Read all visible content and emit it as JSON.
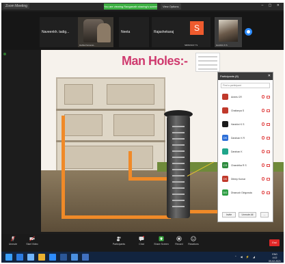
{
  "window": {
    "app_title": "Zoom Meeting"
  },
  "share_bar": {
    "label": "You are viewing Ranganath sharing's screen",
    "view_options": "View Options"
  },
  "participants_strip": [
    {
      "name": "Naveenkh. tadig...",
      "caption": ""
    },
    {
      "name": "",
      "caption": "Harika Kamesw..."
    },
    {
      "name": "Neeta",
      "caption": ""
    },
    {
      "name": "Rajashekaraj",
      "caption": ""
    },
    {
      "name": "",
      "caption": "SRINIVAS T S",
      "avatar_letter": "S"
    },
    {
      "name": "",
      "caption": "Harshini K S"
    }
  ],
  "slide": {
    "title": "Man Holes:-"
  },
  "participants_panel": {
    "title": "Participants (8)",
    "search_placeholder": "Find a participant",
    "items": [
      {
        "name": "Anees CR",
        "avatar_color": "#c0392b",
        "initials": ""
      },
      {
        "name": "Chaitanya S",
        "avatar_color": "#c0392b",
        "initials": ""
      },
      {
        "name": "Harshini K S",
        "avatar_color": "#1c1c1c",
        "initials": ""
      },
      {
        "name": "Darshan K R",
        "avatar_color": "#2d6fd8",
        "initials": "DK"
      },
      {
        "name": "Darshan K",
        "avatar_color": "#1fa58a",
        "initials": ""
      },
      {
        "name": "Chandrika R S",
        "avatar_color": "#2e8b3e",
        "initials": "CS"
      },
      {
        "name": "Dileep Kumar",
        "avatar_color": "#c0392b",
        "initials": "DK"
      },
      {
        "name": "Dhanush Girigowda",
        "avatar_color": "#2e9e44",
        "initials": "DG"
      }
    ],
    "footer": {
      "invite": "Invite",
      "unmute_all": "Unmute All",
      "more": "..."
    }
  },
  "toolbar": {
    "unmute": "Unmute",
    "start_video": "Start Video",
    "participants": "Participants",
    "chat": "Chat",
    "share_screen": "Share Screen",
    "record": "Record",
    "reactions": "Reactions",
    "end": "End"
  },
  "taskbar": {
    "clock_time": "4:02",
    "clock_date": "09-02-2021",
    "lang": "ENG"
  }
}
